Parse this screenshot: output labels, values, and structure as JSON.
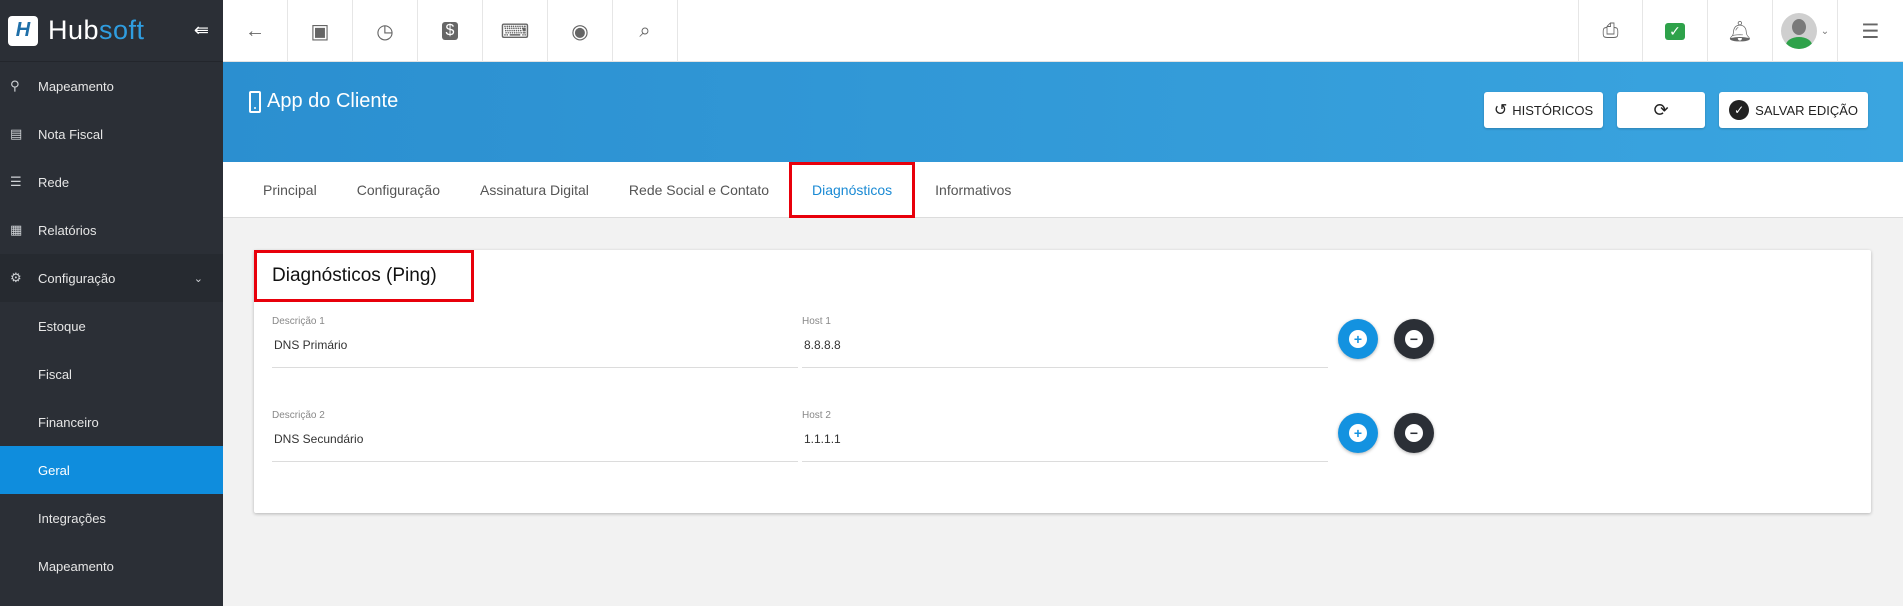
{
  "brand": {
    "name_part1": "Hub",
    "name_part2": "soft",
    "logo_letter": "H"
  },
  "sidebar": {
    "items": [
      {
        "label": "Mapeamento",
        "icon": "map-marker-icon"
      },
      {
        "label": "Nota Fiscal",
        "icon": "receipt-icon"
      },
      {
        "label": "Rede",
        "icon": "server-icon"
      },
      {
        "label": "Relatórios",
        "icon": "document-icon"
      },
      {
        "label": "Configuração",
        "icon": "gear-icon"
      }
    ],
    "subitems": [
      {
        "label": "Estoque"
      },
      {
        "label": "Fiscal"
      },
      {
        "label": "Financeiro"
      },
      {
        "label": "Geral"
      },
      {
        "label": "Integrações"
      },
      {
        "label": "Mapeamento"
      }
    ]
  },
  "topbar": {
    "left_icons": [
      "back-arrow-icon",
      "contact-card-icon",
      "calendar-clock-icon",
      "dollar-icon",
      "terminal-icon",
      "eye-icon",
      "search-icon"
    ],
    "right_icons": [
      "pdf-icon",
      "chat-check-icon",
      "bell-icon",
      "avatar",
      "list-icon"
    ]
  },
  "header": {
    "title": "App do Cliente",
    "historicos_label": "HISTÓRICOS",
    "salvar_label": "SALVAR EDIÇÃO"
  },
  "tabs": [
    {
      "label": "Principal"
    },
    {
      "label": "Configuração"
    },
    {
      "label": "Assinatura Digital"
    },
    {
      "label": "Rede Social e Contato"
    },
    {
      "label": "Diagnósticos"
    },
    {
      "label": "Informativos"
    }
  ],
  "card": {
    "title": "Diagnósticos (Ping)",
    "rows": [
      {
        "desc_label": "Descrição 1",
        "desc_value": "DNS Primário",
        "host_label": "Host 1",
        "host_value": "8.8.8.8"
      },
      {
        "desc_label": "Descrição 2",
        "desc_value": "DNS Secundário",
        "host_label": "Host 2",
        "host_value": "1.1.1.1"
      }
    ]
  },
  "colors": {
    "accent": "#1392e0",
    "sidebar": "#2b2f36",
    "highlight": "#e8000b"
  }
}
